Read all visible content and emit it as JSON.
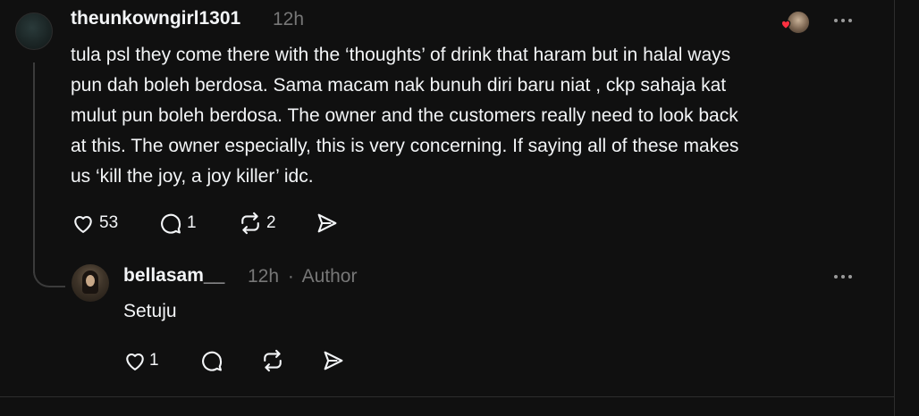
{
  "post": {
    "username": "theunkowngirl1301",
    "time": "12h",
    "text_lines": [
      "tula psl they come there with the ‘thoughts’ of drink that haram but in halal ways",
      "pun dah boleh berdosa. Sama macam nak bunuh diri baru niat , ckp sahaja kat",
      "mulut pun boleh berdosa. The owner and the customers really need to look back",
      "at this. The owner especially, this is very concerning. If saying all of these makes",
      "us ‘kill the joy, a joy killer’ idc."
    ],
    "likes": "53",
    "replies": "1",
    "reposts": "2"
  },
  "reply": {
    "username": "bellasam__",
    "time": "12h",
    "separator": "·",
    "badge": "Author",
    "text": "Setuju",
    "likes": "1"
  },
  "icons": {
    "like": "heart-outline-icon",
    "reply": "speech-bubble-icon",
    "repost": "repost-arrows-icon",
    "share": "send-icon",
    "more": "more-dots-icon",
    "liked": "red-heart-icon"
  },
  "colors": {
    "background": "#101010",
    "text": "#f3f5f7",
    "muted": "#777777",
    "heart": "#ff3040"
  }
}
